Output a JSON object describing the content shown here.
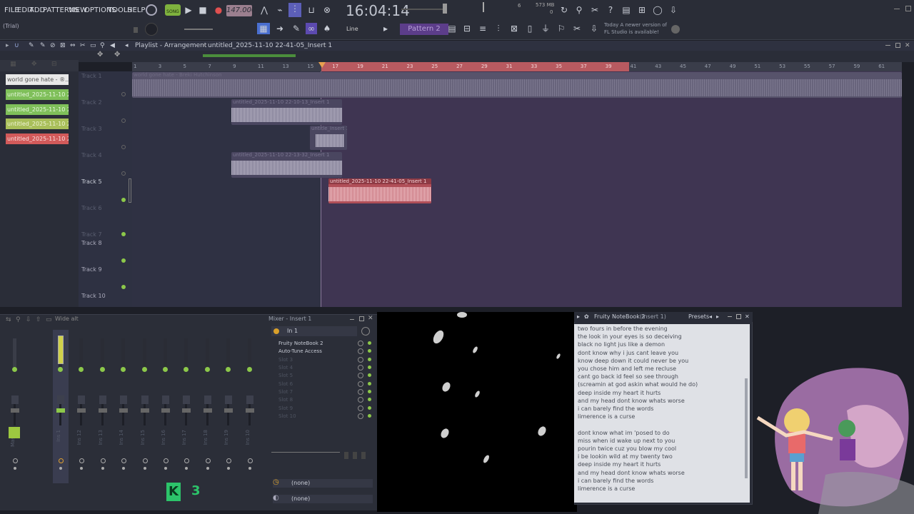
{
  "topbar": {
    "menu": [
      "FILE",
      "EDIT",
      "ADD",
      "PATTERNS",
      "VIEW",
      "OPTIONS",
      "TOOLS",
      "HELP"
    ],
    "trial": "(Trial)",
    "song_label": "SONG",
    "tempo": "147.000",
    "clock": "16:04:14",
    "cpu_num": "6",
    "mem": "573 MB",
    "mem_sub": "0",
    "snap_label": "Line",
    "pattern": "Pattern 2",
    "news_day": "Today",
    "news_text": "A newer version of",
    "news_text2": "FL Studio is available!"
  },
  "playlist": {
    "title": "Playlist - Arrangement",
    "file": "untitled_2025-11-10 22-41-05_Insert 1",
    "ruler": [
      "1",
      "3",
      "5",
      "7",
      "9",
      "11",
      "13",
      "15",
      "17",
      "19",
      "21",
      "23",
      "25",
      "27",
      "29",
      "31",
      "33",
      "35",
      "37",
      "39",
      "41",
      "43",
      "45",
      "47",
      "49",
      "51",
      "53",
      "55",
      "57",
      "59",
      "61"
    ],
    "picker": [
      {
        "label": "world gone hate - ®...",
        "color": "#e3e3e3"
      },
      {
        "label": "untitled_2025-11-10 22-...",
        "color": "#7fbf5a"
      },
      {
        "label": "untitled_2025-11-10 22-...",
        "color": "#7fbf5a"
      },
      {
        "label": "untitled_2025-11-10 22-...",
        "color": "#a9bf5a"
      },
      {
        "label": "untitled_2025-11-10 22-...",
        "color": "#d25a5a"
      }
    ],
    "tracks": [
      "Track 1",
      "Track 2",
      "Track 3",
      "Track 4",
      "Track 5",
      "Track 6",
      "Track 7",
      "Track 8",
      "Track 9",
      "Track 10"
    ],
    "clips": {
      "c1": "world gone hate - Breki Hutchinson",
      "c2": "untitled_2025-11-10 22-10-13_Insert 1",
      "c3": "untitle_Insert 1",
      "c4": "untitled_2025-11-10 22-13-32_Insert 1",
      "c5": "untitled_2025-11-10 22-41-05_Insert 1"
    }
  },
  "mixer": {
    "title": "Mixer - Insert 1",
    "preset": "Wide alt",
    "input": "In 1",
    "slots": [
      "Fruity NoteBook 2",
      "Auto-Tune Access",
      "Slot 3",
      "Slot 4",
      "Slot 5",
      "Slot 6",
      "Slot 7",
      "Slot 8",
      "Slot 9",
      "Slot 10"
    ],
    "strips": [
      "Master",
      "Ins 1",
      "Ins 12",
      "Ins 13",
      "Ins 14",
      "Ins 15",
      "Ins 16",
      "Ins 17",
      "Ins 18",
      "Ins 19",
      "Ins 10"
    ],
    "none1": "(none)",
    "none2": "(none)",
    "badge_num": "3"
  },
  "notebook": {
    "title": "Fruity NoteBook 2",
    "insert": "(Insert 1)",
    "presets": "Presets",
    "lines": [
      "two fours in before the evening",
      "the look in your eyes is so deceiving",
      "black no light jus like a demon",
      "dont know why i jus cant leave you",
      "know deep down it could never be you",
      "you chose him and left me recluse",
      "cant go back id feel so see through",
      "(screamin at god askin what would he do)",
      "deep inside my heart it hurts",
      "and my head dont know whats worse",
      "i can barely find the words",
      "limerence is a curse",
      "",
      "dont know what im 'posed to do",
      "miss when id wake up next to you",
      "pourin twice cuz you blow my cool",
      "i be lookin wild at my twenty two",
      "deep inside my heart it hurts",
      "and my head dont know whats worse",
      "i can barely find the words",
      "limerence is a curse"
    ]
  }
}
